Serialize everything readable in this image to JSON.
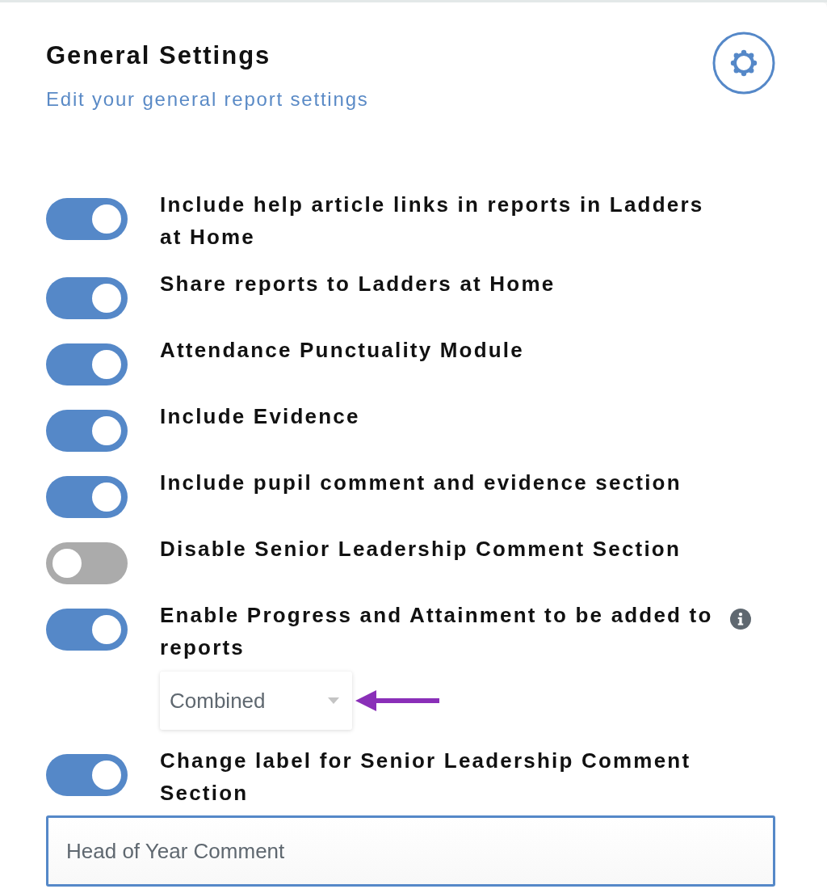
{
  "header": {
    "title": "General Settings",
    "subtitle": "Edit your general report settings"
  },
  "settings": [
    {
      "kind": "toggle",
      "label": "Include help article links in reports in Ladders at Home",
      "on": true
    },
    {
      "kind": "toggle",
      "label": "Share reports to Ladders at Home",
      "on": true
    },
    {
      "kind": "toggle",
      "label": "Attendance Punctuality Module",
      "on": true
    },
    {
      "kind": "toggle",
      "label": "Include Evidence",
      "on": true
    },
    {
      "kind": "toggle",
      "label": "Include pupil comment and evidence section",
      "on": true
    },
    {
      "kind": "toggle",
      "label": "Disable Senior Leadership Comment Section",
      "on": false
    },
    {
      "kind": "select",
      "label": "Enable Progress and Attainment to be added to reports",
      "on": true,
      "value": "Combined"
    },
    {
      "kind": "text",
      "label": "Change label for Senior Leadership Comment Section",
      "on": true,
      "value": "Head of Year Comment"
    }
  ]
}
